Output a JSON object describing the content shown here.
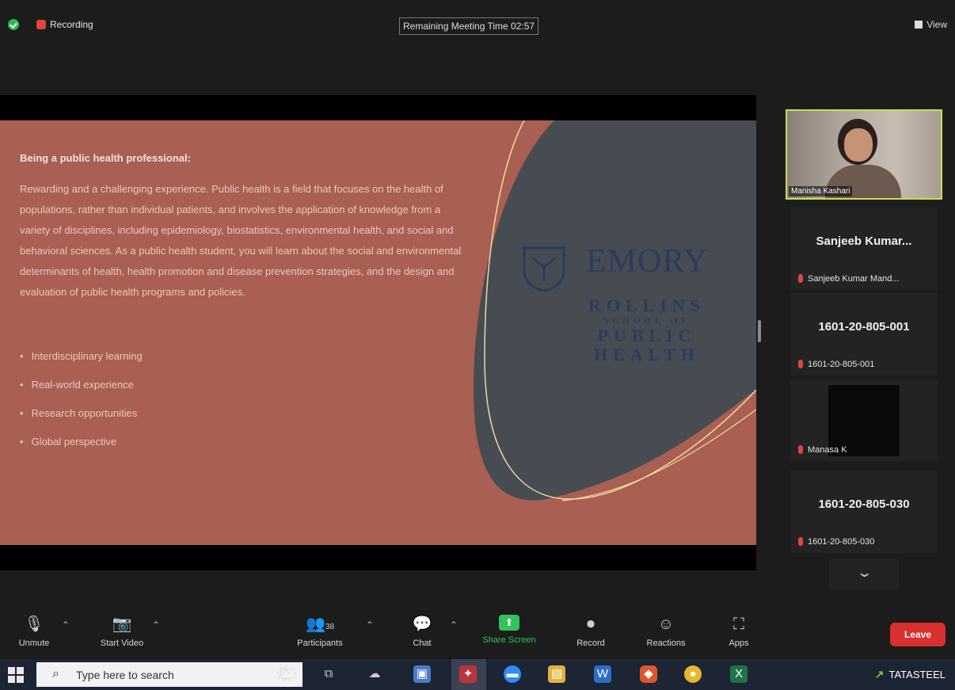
{
  "topbar": {
    "recording_label": "Recording",
    "timer_text": "Remaining Meeting Time 02:57",
    "view_label": "View"
  },
  "slide": {
    "title": "Being a public health professional:",
    "body": "Rewarding and a challenging experience. Public health is a field that focuses on the health of populations, rather than individual patients, and involves the application of knowledge from a variety of disciplines, including epidemiology, biostatistics, environmental health, and social and behavioral sciences. As a public health student, you will learn about the social and environmental determinants of health, health promotion and disease prevention strategies, and the design and evaluation of public health programs and policies.",
    "bullets": [
      "Interdisciplinary learning",
      "Real-world experience",
      "Research opportunities",
      "Global perspective"
    ],
    "logo_name": "EMORY",
    "logo_lines": [
      "ROLLINS",
      "SCHOOL OF",
      "PUBLIC",
      "HEALTH"
    ],
    "colors": {
      "background": "#a95f52",
      "shape": "#474c52",
      "line": "#f0d9a0",
      "logo": "#2e3a5e"
    }
  },
  "participants": {
    "active_name": "Manisha Kashari",
    "tiles": [
      {
        "big": "Sanjeeb Kumar...",
        "sub": "Sanjeeb Kumar Mand..."
      },
      {
        "big": "1601-20-805-001",
        "sub": "1601-20-805-001"
      },
      {
        "big": "",
        "sub": "Manasa K"
      },
      {
        "big": "1601-20-805-030",
        "sub": "1601-20-805-030"
      }
    ],
    "more_icon": "chevron-down-icon"
  },
  "controls": {
    "unmute": "Unmute",
    "start_video": "Start Video",
    "participants": "Participants",
    "participants_count": "38",
    "chat": "Chat",
    "share_screen": "Share Screen",
    "record": "Record",
    "reactions": "Reactions",
    "apps": "Apps",
    "leave": "Leave",
    "accent": "#2fc45c",
    "leave_color": "#d82f2f"
  },
  "taskbar": {
    "search_placeholder": "Type here to search",
    "tray_label": "TATASTEEL"
  }
}
